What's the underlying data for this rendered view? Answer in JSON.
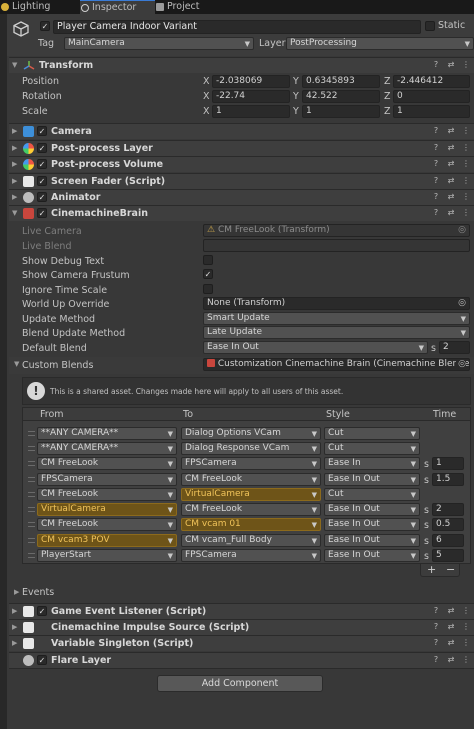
{
  "tabs": [
    {
      "label": "Lighting"
    },
    {
      "label": "Inspector"
    },
    {
      "label": "Project"
    }
  ],
  "object": {
    "name": "Player Camera Indoor Variant",
    "static_label": "Static",
    "tag_label": "Tag",
    "tag_value": "MainCamera",
    "layer_label": "Layer",
    "layer_value": "PostProcessing"
  },
  "transform": {
    "title": "Transform",
    "rows": [
      {
        "label": "Position",
        "x": "-2.038069",
        "y": "0.6345893",
        "z": "-2.446412"
      },
      {
        "label": "Rotation",
        "x": "-22.74",
        "y": "42.522",
        "z": "0"
      },
      {
        "label": "Scale",
        "x": "1",
        "y": "1",
        "z": "1"
      }
    ],
    "axis_x": "X",
    "axis_y": "Y",
    "axis_z": "Z"
  },
  "components": [
    {
      "name": "Camera"
    },
    {
      "name": "Post-process Layer"
    },
    {
      "name": "Post-process Volume"
    },
    {
      "name": "Screen Fader (Script)"
    },
    {
      "name": "Animator"
    },
    {
      "name": "CinemachineBrain"
    }
  ],
  "brain": {
    "live_camera_label": "Live Camera",
    "live_camera_value": "CM FreeLook (Transform)",
    "live_blend_label": "Live Blend",
    "show_debug_label": "Show Debug Text",
    "show_frustum_label": "Show Camera Frustum",
    "ignore_time_label": "Ignore Time Scale",
    "world_up_label": "World Up Override",
    "world_up_value": "None (Transform)",
    "update_method_label": "Update Method",
    "update_method_value": "Smart Update",
    "blend_update_label": "Blend Update Method",
    "blend_update_value": "Late Update",
    "default_blend_label": "Default Blend",
    "default_blend_value": "Ease In Out",
    "default_blend_s_label": "s",
    "default_blend_time": "2",
    "custom_blends_label": "Custom Blends",
    "custom_blends_value": "Customization Cinemachine Brain (Cinemachine Blender",
    "shared_asset_msg": "This is a shared asset.  Changes made here will apply to all users of this asset."
  },
  "blends_table": {
    "headers": {
      "from": "From",
      "to": "To",
      "style": "Style",
      "time": "Time"
    },
    "s_label": "s",
    "rows": [
      {
        "from": "**ANY CAMERA**",
        "to": "Dialog Options VCam",
        "style": "Cut",
        "time": ""
      },
      {
        "from": "**ANY CAMERA**",
        "to": "Dialog Response VCam",
        "style": "Cut",
        "time": ""
      },
      {
        "from": "CM FreeLook",
        "to": "FPSCamera",
        "style": "Ease In",
        "time": "1"
      },
      {
        "from": "FPSCamera",
        "to": "CM FreeLook",
        "style": "Ease In Out",
        "time": "1.5"
      },
      {
        "from": "CM FreeLook",
        "to": "VirtualCamera",
        "style": "Cut",
        "time": ""
      },
      {
        "from": "VirtualCamera",
        "to": "CM FreeLook",
        "style": "Ease In Out",
        "time": "2"
      },
      {
        "from": "CM FreeLook",
        "to": "CM vcam 01",
        "style": "Ease In Out",
        "time": "0.5"
      },
      {
        "from": "CM vcam3 POV",
        "to": "CM vcam_Full Body",
        "style": "Ease In Out",
        "time": "6"
      },
      {
        "from": "PlayerStart",
        "to": "FPSCamera",
        "style": "Ease In Out",
        "time": "5"
      }
    ],
    "add_label": "+",
    "remove_label": "−"
  },
  "events_label": "Events",
  "components_bottom": [
    {
      "name": "Game Event Listener (Script)"
    },
    {
      "name": "Cinemachine Impulse Source (Script)"
    },
    {
      "name": "Variable Singleton (Script)"
    },
    {
      "name": "Flare Layer"
    }
  ],
  "add_component_label": "Add Component",
  "colors": {
    "highlight": "#f0c35a",
    "accent": "#3a7bd5"
  }
}
